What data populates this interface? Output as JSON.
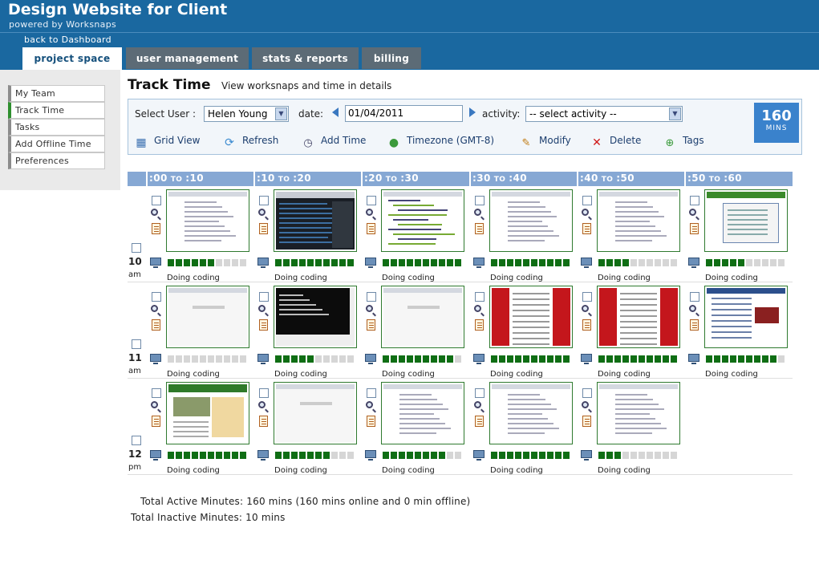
{
  "header": {
    "title": "Design Website for Client",
    "powered_by": "powered by Worksnaps",
    "back_link": "back to Dashboard"
  },
  "tabs": [
    {
      "label": "project space",
      "active": true
    },
    {
      "label": "user management",
      "active": false
    },
    {
      "label": "stats & reports",
      "active": false
    },
    {
      "label": "billing",
      "active": false
    }
  ],
  "sidebar": {
    "items": [
      {
        "label": "My Team",
        "active": false
      },
      {
        "label": "Track Time",
        "active": true
      },
      {
        "label": "Tasks",
        "active": false
      },
      {
        "label": "Add Offline Time",
        "active": false
      },
      {
        "label": "Preferences",
        "active": false
      }
    ]
  },
  "main": {
    "title": "Track Time",
    "subtitle": "View worksnaps and time in details"
  },
  "toolbar": {
    "select_user_label": "Select User :",
    "user_value": "Helen Young",
    "date_label": "date:",
    "date_value": "01/04/2011",
    "activity_label": "activity:",
    "activity_value": "-- select activity --",
    "actions": [
      {
        "label": "Grid View",
        "icon": "grid-icon"
      },
      {
        "label": "Refresh",
        "icon": "refresh-icon"
      },
      {
        "label": "Add Time",
        "icon": "clock-add-icon"
      },
      {
        "label": "Timezone (GMT-8)",
        "icon": "globe-icon"
      },
      {
        "label": "Modify",
        "icon": "pencil-icon"
      },
      {
        "label": "Delete",
        "icon": "delete-x-icon"
      },
      {
        "label": "Tags",
        "icon": "tag-plus-icon"
      }
    ],
    "minutes_total": "160",
    "minutes_unit": "MINS"
  },
  "grid": {
    "columns": [
      {
        "from": ":00",
        "to_word": "TO",
        "until": ":10"
      },
      {
        "from": ":10",
        "to_word": "TO",
        "until": ":20"
      },
      {
        "from": ":20",
        "to_word": "TO",
        "until": ":30"
      },
      {
        "from": ":30",
        "to_word": "TO",
        "until": ":40"
      },
      {
        "from": ":40",
        "to_word": "TO",
        "until": ":50"
      },
      {
        "from": ":50",
        "to_word": "TO",
        "until": ":60"
      }
    ],
    "rows": [
      {
        "hour": "10",
        "ampm": "am",
        "slots": [
          {
            "activity": "Doing coding",
            "level": 6,
            "screen": "doc"
          },
          {
            "activity": "Doing coding",
            "level": 10,
            "screen": "dark"
          },
          {
            "activity": "Doing coding",
            "level": 10,
            "screen": "code"
          },
          {
            "activity": "Doing coding",
            "level": 10,
            "screen": "doc"
          },
          {
            "activity": "Doing coding",
            "level": 4,
            "screen": "doc"
          },
          {
            "activity": "Doing coding",
            "level": 5,
            "screen": "green"
          }
        ]
      },
      {
        "hour": "11",
        "ampm": "am",
        "slots": [
          {
            "activity": "Doing coding",
            "level": 0,
            "screen": "blank"
          },
          {
            "activity": "Doing coding",
            "level": 5,
            "screen": "terminal"
          },
          {
            "activity": "Doing coding",
            "level": 9,
            "screen": "blank"
          },
          {
            "activity": "Doing coding",
            "level": 10,
            "screen": "red"
          },
          {
            "activity": "Doing coding",
            "level": 10,
            "screen": "red"
          },
          {
            "activity": "Doing coding",
            "level": 9,
            "screen": "web"
          }
        ]
      },
      {
        "hour": "12",
        "ampm": "pm",
        "slots": [
          {
            "activity": "Doing coding",
            "level": 10,
            "screen": "site"
          },
          {
            "activity": "Doing coding",
            "level": 7,
            "screen": "blank"
          },
          {
            "activity": "Doing coding",
            "level": 8,
            "screen": "doc"
          },
          {
            "activity": "Doing coding",
            "level": 10,
            "screen": "doc"
          },
          {
            "activity": "Doing coding",
            "level": 3,
            "screen": "doc"
          }
        ]
      }
    ]
  },
  "totals": {
    "active": "Total Active Minutes: 160 mins (160 mins online and 0 min offline)",
    "inactive": "Total Inactive Minutes: 10 mins"
  },
  "colors": {
    "header_bg": "#1a68a0",
    "bar_active": "#0f6e14",
    "bar_inactive": "#d6d6d6",
    "mins_box": "#3a82cc"
  }
}
